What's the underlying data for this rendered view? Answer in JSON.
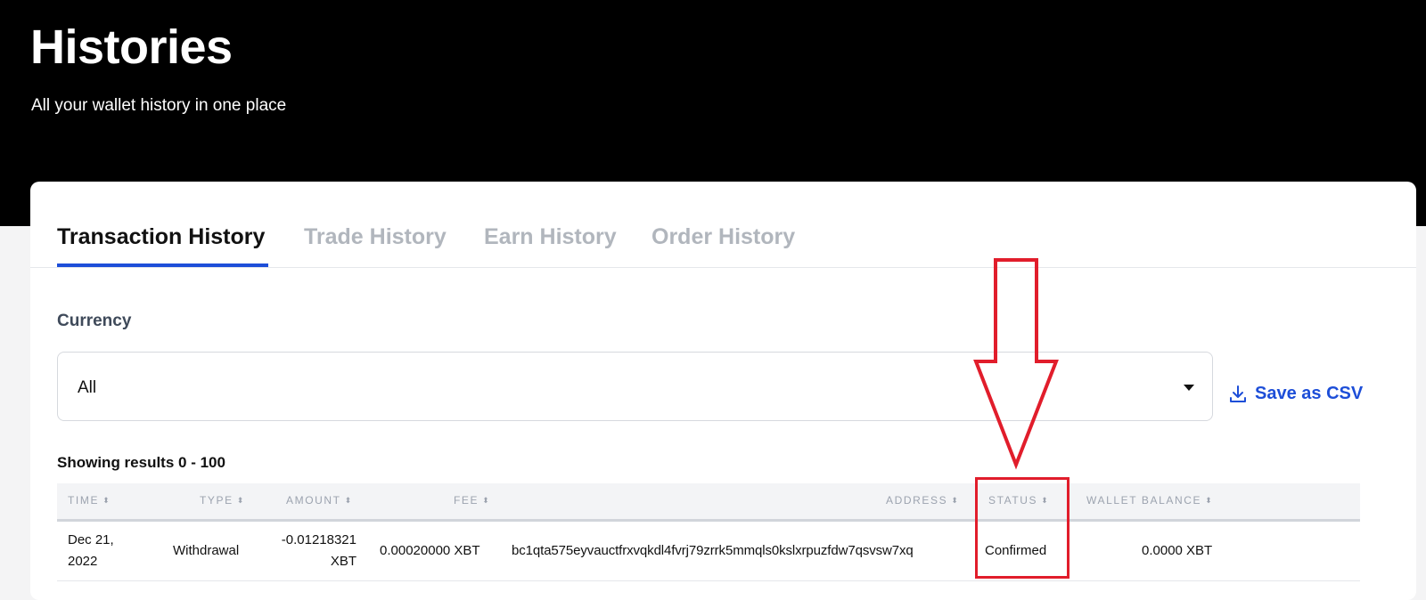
{
  "header": {
    "title": "Histories",
    "subtitle": "All your wallet history in one place"
  },
  "tabs": [
    {
      "label": "Transaction History",
      "active": true
    },
    {
      "label": "Trade History",
      "active": false
    },
    {
      "label": "Earn History",
      "active": false
    },
    {
      "label": "Order History",
      "active": false
    }
  ],
  "filter": {
    "label": "Currency",
    "selected": "All"
  },
  "actions": {
    "save_csv_label": "Save as CSV",
    "save_csv_icon": "download-icon"
  },
  "results_text": "Showing results 0 - 100",
  "table": {
    "columns": [
      "TIME",
      "TYPE",
      "AMOUNT",
      "FEE",
      "ADDRESS",
      "STATUS",
      "WALLET BALANCE"
    ],
    "rows": [
      {
        "time_line1": "Dec 21,",
        "time_line2": "2022",
        "type": "Withdrawal",
        "amount_line1": "-0.01218321",
        "amount_line2": "XBT",
        "fee": "0.00020000 XBT",
        "address": "bc1qta575eyvauctfrxvqkdl4fvrj79zrrk5mmqls0kslxrpuzfdw7qsvsw7xq",
        "status": "Confirmed",
        "wallet_balance": "0.0000 XBT"
      }
    ]
  },
  "colors": {
    "accent": "#1d4ed8",
    "annotation": "#e11d2b",
    "hero_bg": "#000000"
  }
}
